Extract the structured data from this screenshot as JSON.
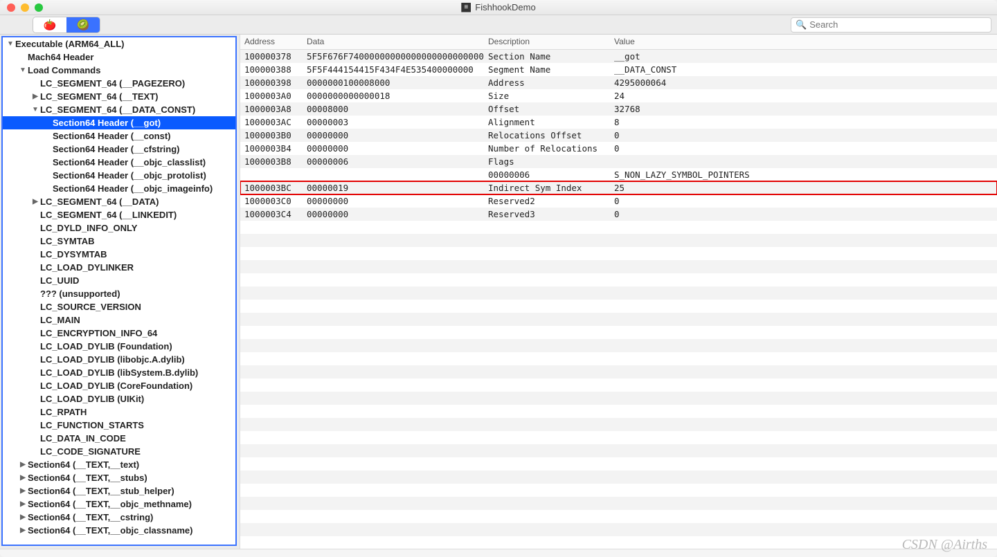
{
  "window": {
    "title": "FishhookDemo"
  },
  "toolbar": {
    "seg1_emoji": "🍅",
    "seg2_emoji": "🥝",
    "search_placeholder": "Search"
  },
  "sidebar": {
    "items": [
      {
        "level": 0,
        "disc": "open",
        "label": "Executable  (ARM64_ALL)"
      },
      {
        "level": 1,
        "disc": "none",
        "label": "Mach64 Header"
      },
      {
        "level": 1,
        "disc": "open",
        "label": "Load Commands"
      },
      {
        "level": 2,
        "disc": "none",
        "label": "LC_SEGMENT_64 (__PAGEZERO)"
      },
      {
        "level": 2,
        "disc": "closed",
        "label": "LC_SEGMENT_64 (__TEXT)"
      },
      {
        "level": 2,
        "disc": "open",
        "label": "LC_SEGMENT_64 (__DATA_CONST)"
      },
      {
        "level": 3,
        "disc": "none",
        "label": "Section64 Header (__got)",
        "selected": true
      },
      {
        "level": 3,
        "disc": "none",
        "label": "Section64 Header (__const)"
      },
      {
        "level": 3,
        "disc": "none",
        "label": "Section64 Header (__cfstring)"
      },
      {
        "level": 3,
        "disc": "none",
        "label": "Section64 Header (__objc_classlist)"
      },
      {
        "level": 3,
        "disc": "none",
        "label": "Section64 Header (__objc_protolist)"
      },
      {
        "level": 3,
        "disc": "none",
        "label": "Section64 Header (__objc_imageinfo)"
      },
      {
        "level": 2,
        "disc": "closed",
        "label": "LC_SEGMENT_64 (__DATA)"
      },
      {
        "level": 2,
        "disc": "none",
        "label": "LC_SEGMENT_64 (__LINKEDIT)"
      },
      {
        "level": 2,
        "disc": "none",
        "label": "LC_DYLD_INFO_ONLY"
      },
      {
        "level": 2,
        "disc": "none",
        "label": "LC_SYMTAB"
      },
      {
        "level": 2,
        "disc": "none",
        "label": "LC_DYSYMTAB"
      },
      {
        "level": 2,
        "disc": "none",
        "label": "LC_LOAD_DYLINKER"
      },
      {
        "level": 2,
        "disc": "none",
        "label": "LC_UUID"
      },
      {
        "level": 2,
        "disc": "none",
        "label": "??? (unsupported)"
      },
      {
        "level": 2,
        "disc": "none",
        "label": "LC_SOURCE_VERSION"
      },
      {
        "level": 2,
        "disc": "none",
        "label": "LC_MAIN"
      },
      {
        "level": 2,
        "disc": "none",
        "label": "LC_ENCRYPTION_INFO_64"
      },
      {
        "level": 2,
        "disc": "none",
        "label": "LC_LOAD_DYLIB (Foundation)"
      },
      {
        "level": 2,
        "disc": "none",
        "label": "LC_LOAD_DYLIB (libobjc.A.dylib)"
      },
      {
        "level": 2,
        "disc": "none",
        "label": "LC_LOAD_DYLIB (libSystem.B.dylib)"
      },
      {
        "level": 2,
        "disc": "none",
        "label": "LC_LOAD_DYLIB (CoreFoundation)"
      },
      {
        "level": 2,
        "disc": "none",
        "label": "LC_LOAD_DYLIB (UIKit)"
      },
      {
        "level": 2,
        "disc": "none",
        "label": "LC_RPATH"
      },
      {
        "level": 2,
        "disc": "none",
        "label": "LC_FUNCTION_STARTS"
      },
      {
        "level": 2,
        "disc": "none",
        "label": "LC_DATA_IN_CODE"
      },
      {
        "level": 2,
        "disc": "none",
        "label": "LC_CODE_SIGNATURE"
      },
      {
        "level": 1,
        "disc": "closed",
        "label": "Section64 (__TEXT,__text)"
      },
      {
        "level": 1,
        "disc": "closed",
        "label": "Section64 (__TEXT,__stubs)"
      },
      {
        "level": 1,
        "disc": "closed",
        "label": "Section64 (__TEXT,__stub_helper)"
      },
      {
        "level": 1,
        "disc": "closed",
        "label": "Section64 (__TEXT,__objc_methname)"
      },
      {
        "level": 1,
        "disc": "closed",
        "label": "Section64 (__TEXT,__cstring)"
      },
      {
        "level": 1,
        "disc": "closed",
        "label": "Section64 (__TEXT,__objc_classname)"
      }
    ]
  },
  "table": {
    "headers": {
      "address": "Address",
      "data": "Data",
      "description": "Description",
      "value": "Value"
    },
    "rows": [
      {
        "addr": "100000378",
        "data": "5F5F676F74000000000000000000000000",
        "desc": "Section Name",
        "val": "__got"
      },
      {
        "addr": "100000388",
        "data": "5F5F444154415F434F4E535400000000",
        "desc": "Segment Name",
        "val": "__DATA_CONST"
      },
      {
        "addr": "100000398",
        "data": "0000000100008000",
        "desc": "Address",
        "val": "4295000064"
      },
      {
        "addr": "1000003A0",
        "data": "0000000000000018",
        "desc": "Size",
        "val": "24"
      },
      {
        "addr": "1000003A8",
        "data": "00008000",
        "desc": "Offset",
        "val": "32768"
      },
      {
        "addr": "1000003AC",
        "data": "00000003",
        "desc": "Alignment",
        "val": "8"
      },
      {
        "addr": "1000003B0",
        "data": "00000000",
        "desc": "Relocations Offset",
        "val": "0"
      },
      {
        "addr": "1000003B4",
        "data": "00000000",
        "desc": "Number of Relocations",
        "val": "0"
      },
      {
        "addr": "1000003B8",
        "data": "00000006",
        "desc": "Flags",
        "val": ""
      },
      {
        "addr": "",
        "data": "",
        "desc": "00000006",
        "val": "S_NON_LAZY_SYMBOL_POINTERS"
      },
      {
        "addr": "1000003BC",
        "data": "00000019",
        "desc": "Indirect Sym Index",
        "val": "25",
        "highlight": true
      },
      {
        "addr": "1000003C0",
        "data": "00000000",
        "desc": "Reserved2",
        "val": "0"
      },
      {
        "addr": "1000003C4",
        "data": "00000000",
        "desc": "Reserved3",
        "val": "0"
      }
    ],
    "empty_rows": 26
  },
  "watermark": "CSDN @Airths"
}
